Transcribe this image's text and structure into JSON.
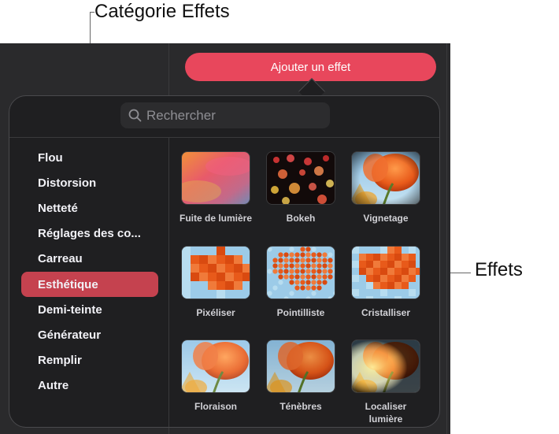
{
  "callouts": {
    "category": "Catégorie Effets",
    "effects": "Effets"
  },
  "toolbar": {
    "add_effect_label": "Ajouter un effet"
  },
  "search": {
    "placeholder": "Rechercher"
  },
  "categories": [
    {
      "label": "Flou",
      "selected": false
    },
    {
      "label": "Distorsion",
      "selected": false
    },
    {
      "label": "Netteté",
      "selected": false
    },
    {
      "label": "Réglages des co...",
      "selected": false
    },
    {
      "label": "Carreau",
      "selected": false
    },
    {
      "label": "Esthétique",
      "selected": true
    },
    {
      "label": "Demi-teinte",
      "selected": false
    },
    {
      "label": "Générateur",
      "selected": false
    },
    {
      "label": "Remplir",
      "selected": false
    },
    {
      "label": "Autre",
      "selected": false
    }
  ],
  "effects": [
    {
      "label": "Fuite de lumière",
      "icon": "light-leak-thumb"
    },
    {
      "label": "Bokeh",
      "icon": "bokeh-thumb"
    },
    {
      "label": "Vignetage",
      "icon": "vignette-thumb"
    },
    {
      "label": "Pixéliser",
      "icon": "pixelate-thumb"
    },
    {
      "label": "Pointilliste",
      "icon": "pointillize-thumb"
    },
    {
      "label": "Cristalliser",
      "icon": "crystallize-thumb"
    },
    {
      "label": "Floraison",
      "icon": "bloom-thumb"
    },
    {
      "label": "Ténèbres",
      "icon": "gloom-thumb"
    },
    {
      "label": "Localiser lumière",
      "icon": "spotlight-thumb"
    }
  ],
  "colors": {
    "accent": "#e8475c",
    "selected_category": "#c5424f",
    "popover_bg": "#1f1f21"
  }
}
